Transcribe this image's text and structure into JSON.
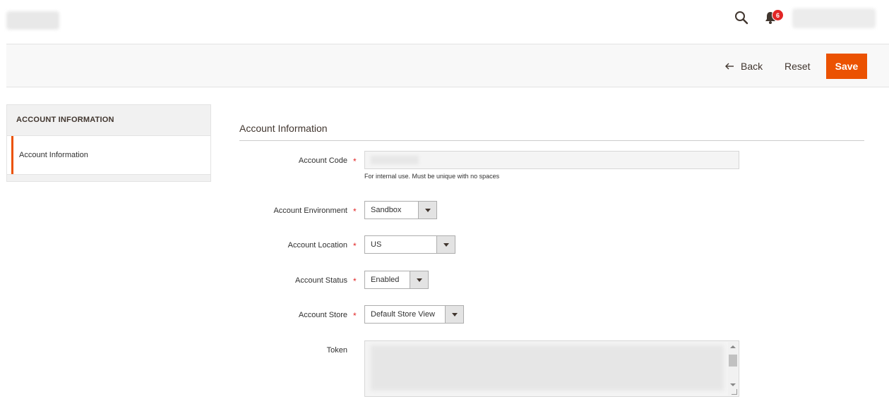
{
  "header": {
    "notification_count": "6"
  },
  "actions": {
    "back_label": "Back",
    "reset_label": "Reset",
    "save_label": "Save"
  },
  "sidebar": {
    "title": "ACCOUNT INFORMATION",
    "items": [
      {
        "label": "Account Information",
        "active": true
      }
    ]
  },
  "form": {
    "section_title": "Account Information",
    "account_code": {
      "label": "Account Code",
      "required": "*",
      "value": "",
      "note": "For internal use. Must be unique with no spaces"
    },
    "account_environment": {
      "label": "Account Environment",
      "required": "*",
      "value": "Sandbox"
    },
    "account_location": {
      "label": "Account Location",
      "required": "*",
      "value": "US"
    },
    "account_status": {
      "label": "Account Status",
      "required": "*",
      "value": "Enabled"
    },
    "account_store": {
      "label": "Account Store",
      "required": "*",
      "value": "Default Store View"
    },
    "token": {
      "label": "Token",
      "value": ""
    }
  },
  "colors": {
    "accent": "#eb5202",
    "required": "#e22626",
    "badge": "#e22626"
  },
  "icons": {
    "search": "search-icon",
    "notifications": "bell-icon",
    "back": "arrow-left-icon",
    "dropdown": "chevron-down-icon"
  }
}
